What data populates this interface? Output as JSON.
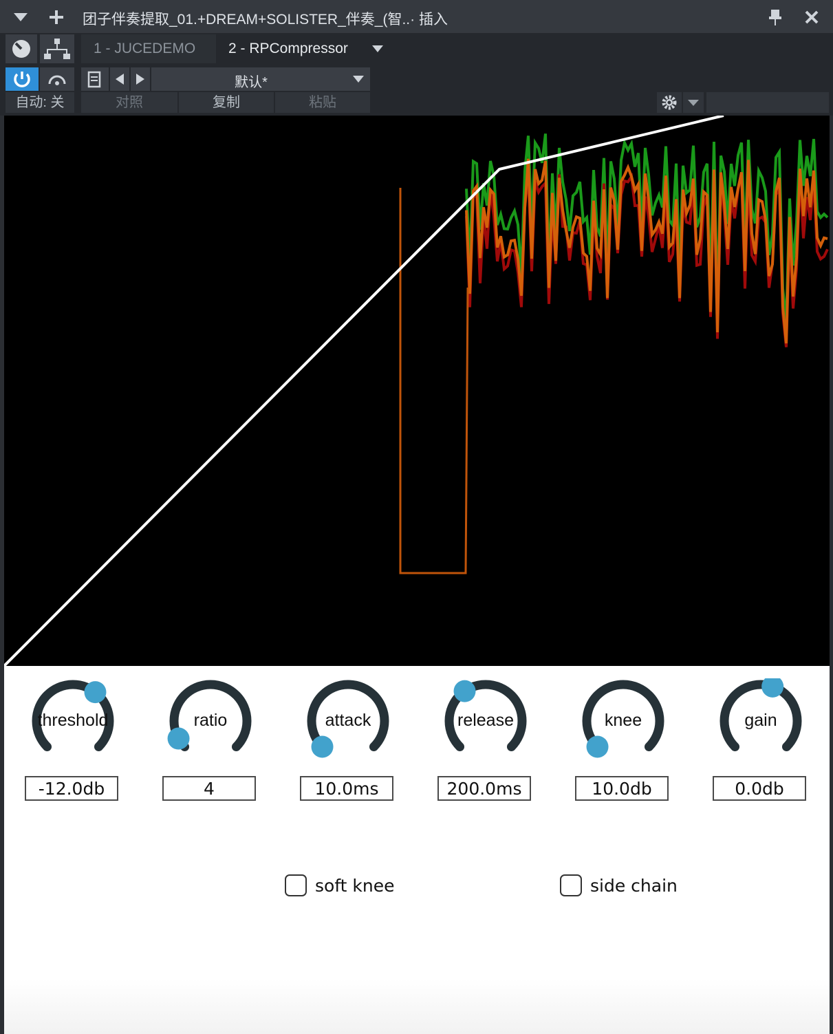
{
  "window": {
    "title": "团子伴奏提取_01.+DREAM+SOLISTER_伴奏_(智..· 插入",
    "menu_icon": "triangle-down-icon",
    "add_icon": "plus-icon",
    "pin_icon": "pin-icon",
    "close_icon": "close-icon"
  },
  "tabs": [
    {
      "label": "1 - JUCEDEMO"
    },
    {
      "label": "2 - RPCompressor"
    }
  ],
  "toolbar": {
    "preset_name": "默认*",
    "automation_label": "自动: 关",
    "compare_label": "对照",
    "copy_label": "复制",
    "paste_label": "粘贴",
    "power_color": "#2f8fd8"
  },
  "knobs": [
    {
      "label": "threshold",
      "value": "-12.0db",
      "level": 0.64
    },
    {
      "label": "ratio",
      "value": "4",
      "level": 0.06
    },
    {
      "label": "attack",
      "value": "10.0ms",
      "level": 0.0
    },
    {
      "label": "release",
      "value": "200.0ms",
      "level": 0.37
    },
    {
      "label": "knee",
      "value": "10.0db",
      "level": 0.0
    },
    {
      "label": "gain",
      "value": "0.0db",
      "level": 0.57
    }
  ],
  "checkboxes": [
    {
      "label": "soft knee",
      "checked": false
    },
    {
      "label": "side chain",
      "checked": false
    }
  ],
  "colors": {
    "knob_track": "#263238",
    "knob_thumb": "#42a2cc",
    "curve": "#ffffff",
    "meter_green": "#1a9a1a",
    "meter_red": "#a00a0a",
    "meter_orange": "#d4600a"
  }
}
